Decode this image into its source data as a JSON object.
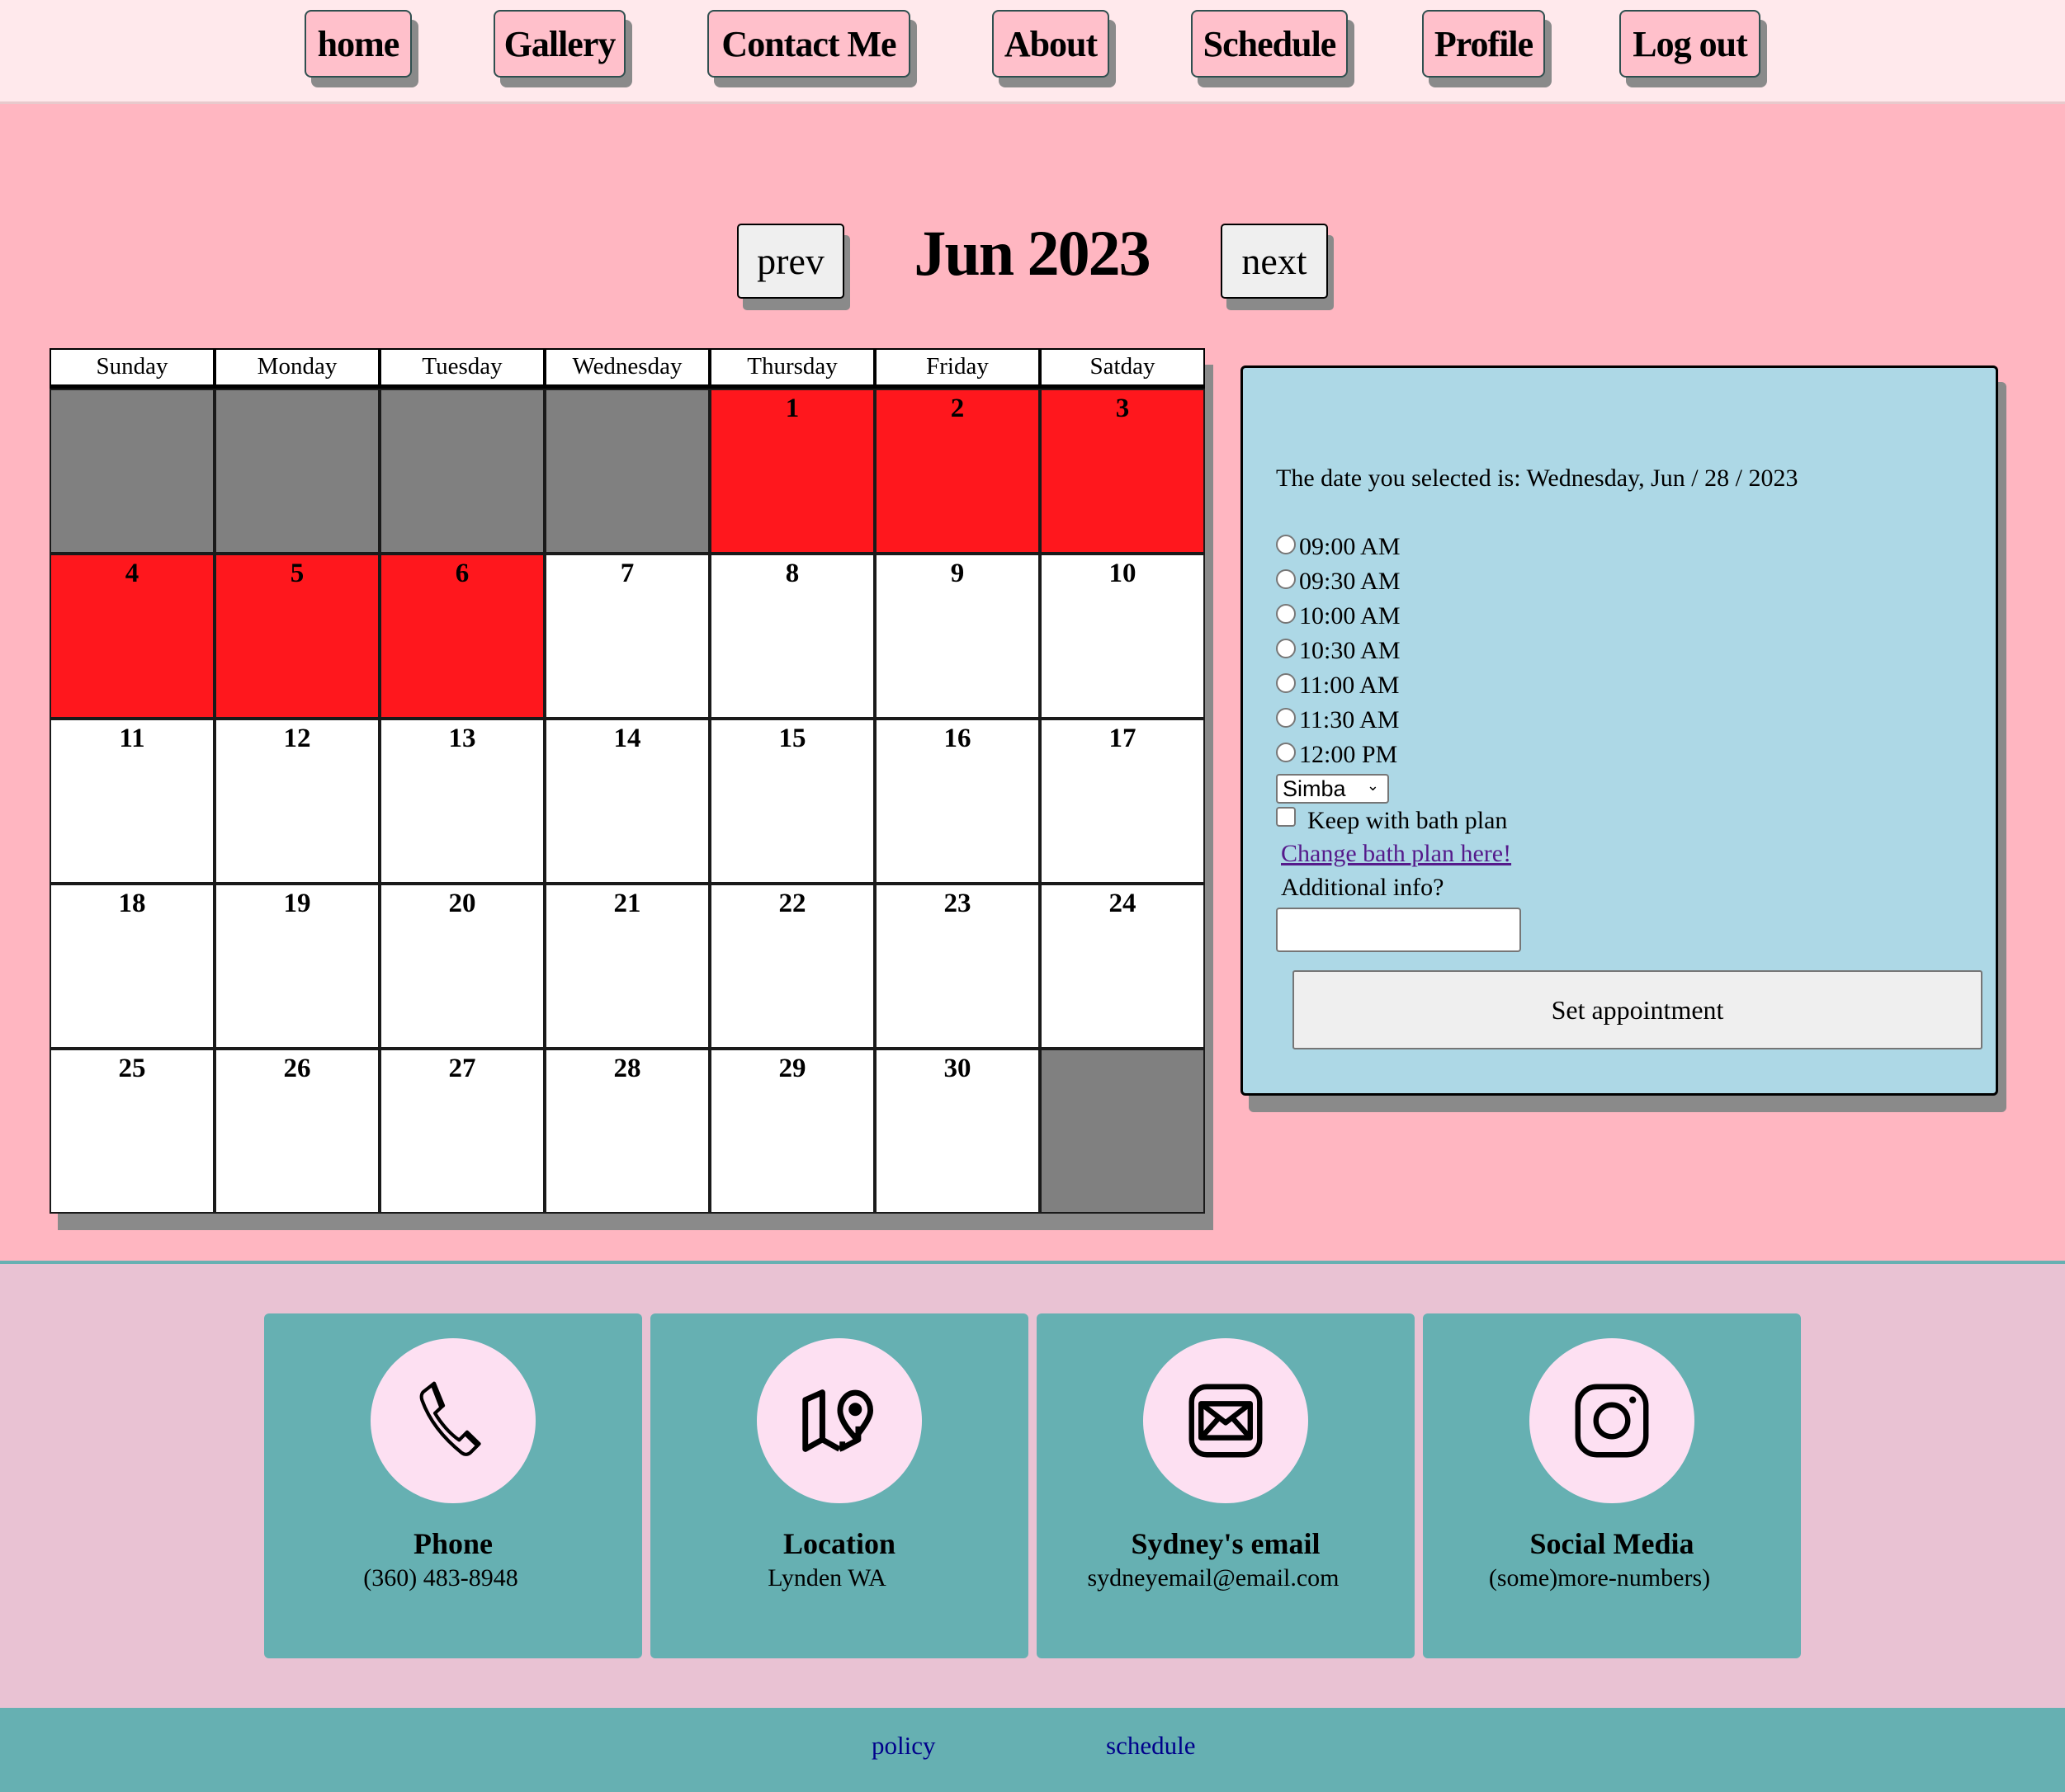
{
  "nav": {
    "items": [
      {
        "label": "home"
      },
      {
        "label": "Gallery"
      },
      {
        "label": "Contact Me"
      },
      {
        "label": "About"
      },
      {
        "label": "Schedule"
      },
      {
        "label": "Profile"
      },
      {
        "label": "Log out"
      }
    ]
  },
  "calendar": {
    "prev_label": "prev",
    "next_label": "next",
    "month_title": "Jun 2023",
    "weekdays": [
      "Sunday",
      "Monday",
      "Tuesday",
      "Wednesday",
      "Thursday",
      "Friday",
      "Satday"
    ],
    "cells": [
      {
        "day": "",
        "state": "empty"
      },
      {
        "day": "",
        "state": "empty"
      },
      {
        "day": "",
        "state": "empty"
      },
      {
        "day": "",
        "state": "empty"
      },
      {
        "day": "1",
        "state": "booked"
      },
      {
        "day": "2",
        "state": "booked"
      },
      {
        "day": "3",
        "state": "booked"
      },
      {
        "day": "4",
        "state": "booked"
      },
      {
        "day": "5",
        "state": "booked"
      },
      {
        "day": "6",
        "state": "booked"
      },
      {
        "day": "7",
        "state": "open"
      },
      {
        "day": "8",
        "state": "open"
      },
      {
        "day": "9",
        "state": "open"
      },
      {
        "day": "10",
        "state": "open"
      },
      {
        "day": "11",
        "state": "open"
      },
      {
        "day": "12",
        "state": "open"
      },
      {
        "day": "13",
        "state": "open"
      },
      {
        "day": "14",
        "state": "open"
      },
      {
        "day": "15",
        "state": "open"
      },
      {
        "day": "16",
        "state": "open"
      },
      {
        "day": "17",
        "state": "open"
      },
      {
        "day": "18",
        "state": "open"
      },
      {
        "day": "19",
        "state": "open"
      },
      {
        "day": "20",
        "state": "open"
      },
      {
        "day": "21",
        "state": "open"
      },
      {
        "day": "22",
        "state": "open"
      },
      {
        "day": "23",
        "state": "open"
      },
      {
        "day": "24",
        "state": "open"
      },
      {
        "day": "25",
        "state": "open"
      },
      {
        "day": "26",
        "state": "open"
      },
      {
        "day": "27",
        "state": "open"
      },
      {
        "day": "28",
        "state": "open"
      },
      {
        "day": "29",
        "state": "open"
      },
      {
        "day": "30",
        "state": "open"
      },
      {
        "day": "",
        "state": "empty"
      }
    ],
    "colors": {
      "booked": "#ff171d",
      "empty": "#808080",
      "open": "#ffffff"
    }
  },
  "appointment": {
    "selected_date_text": "The date you selected is: Wednesday, Jun / 28 / 2023",
    "time_slots": [
      "09:00 AM",
      "09:30 AM",
      "10:00 AM",
      "10:30 AM",
      "11:00 AM",
      "11:30 AM",
      "12:00 PM"
    ],
    "selected_time": null,
    "pet_select_value": "Simba",
    "keep_bath_plan_label": "Keep with bath plan",
    "keep_bath_plan_checked": false,
    "change_bath_plan_link": "Change bath plan here!",
    "additional_info_label": "Additional info?",
    "additional_info_value": "",
    "submit_label": "Set appointment"
  },
  "contact": {
    "cards": [
      {
        "icon": "phone-icon",
        "title": "Phone",
        "value": "(360) 483-8948"
      },
      {
        "icon": "map-pin-icon",
        "title": "Location",
        "value": "Lynden WA"
      },
      {
        "icon": "email-icon",
        "title": "Sydney's email",
        "value": "sydneyemail@email.com"
      },
      {
        "icon": "instagram-icon",
        "title": "Social Media",
        "value": "(some)more-numbers)"
      }
    ]
  },
  "footer": {
    "links": [
      {
        "label": "policy"
      },
      {
        "label": "schedule"
      }
    ]
  }
}
